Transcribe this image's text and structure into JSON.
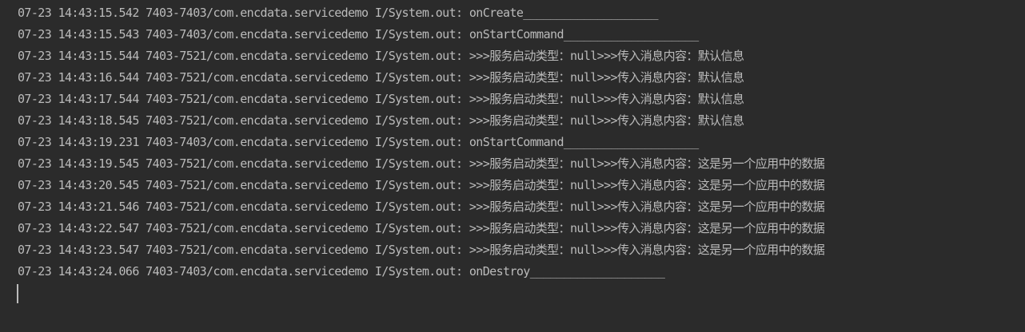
{
  "console": {
    "lines": [
      "07-23 14:43:15.542 7403-7403/com.encdata.servicedemo I/System.out: onCreate____________________",
      "07-23 14:43:15.543 7403-7403/com.encdata.servicedemo I/System.out: onStartCommand____________________",
      "07-23 14:43:15.544 7403-7521/com.encdata.servicedemo I/System.out: >>>服务启动类型：null>>>传入消息内容：默认信息",
      "07-23 14:43:16.544 7403-7521/com.encdata.servicedemo I/System.out: >>>服务启动类型：null>>>传入消息内容：默认信息",
      "07-23 14:43:17.544 7403-7521/com.encdata.servicedemo I/System.out: >>>服务启动类型：null>>>传入消息内容：默认信息",
      "07-23 14:43:18.545 7403-7521/com.encdata.servicedemo I/System.out: >>>服务启动类型：null>>>传入消息内容：默认信息",
      "07-23 14:43:19.231 7403-7403/com.encdata.servicedemo I/System.out: onStartCommand____________________",
      "07-23 14:43:19.545 7403-7521/com.encdata.servicedemo I/System.out: >>>服务启动类型：null>>>传入消息内容：这是另一个应用中的数据",
      "07-23 14:43:20.545 7403-7521/com.encdata.servicedemo I/System.out: >>>服务启动类型：null>>>传入消息内容：这是另一个应用中的数据",
      "07-23 14:43:21.546 7403-7521/com.encdata.servicedemo I/System.out: >>>服务启动类型：null>>>传入消息内容：这是另一个应用中的数据",
      "07-23 14:43:22.547 7403-7521/com.encdata.servicedemo I/System.out: >>>服务启动类型：null>>>传入消息内容：这是另一个应用中的数据",
      "07-23 14:43:23.547 7403-7521/com.encdata.servicedemo I/System.out: >>>服务启动类型：null>>>传入消息内容：这是另一个应用中的数据",
      "07-23 14:43:24.066 7403-7403/com.encdata.servicedemo I/System.out: onDestroy____________________"
    ],
    "colors": {
      "background": "#2b2b2b",
      "text": "#bbbbbb",
      "caret": "#bbbbbb"
    }
  }
}
